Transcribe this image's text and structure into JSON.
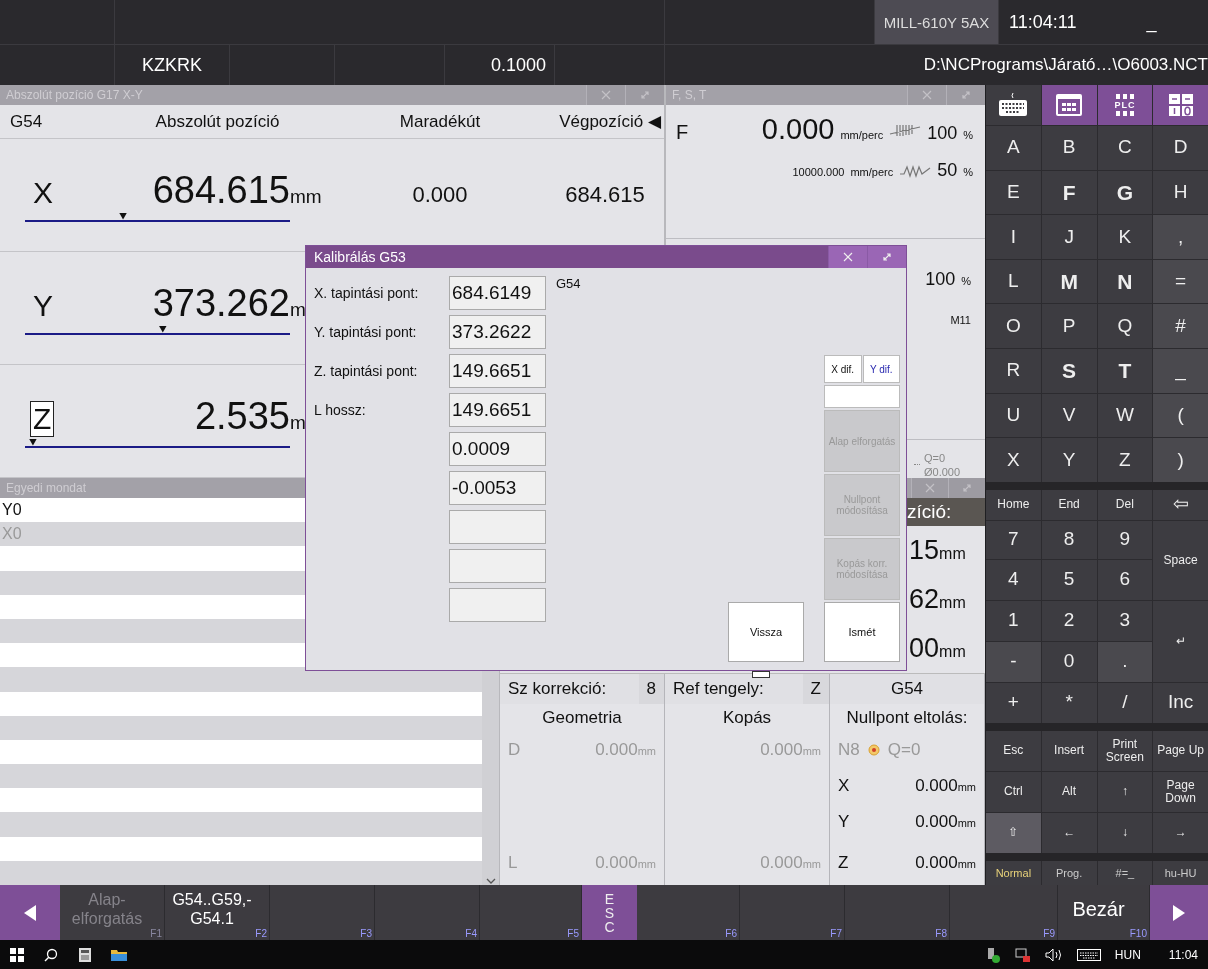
{
  "top_bar": {
    "machine": "MILL-610Y 5AX",
    "clock": "11:04:11",
    "minimize": "_",
    "mode": "KZKRK",
    "increment": "0.1000",
    "program_path": "D:\\NCPrograms\\Járató…\\O6003.NCT"
  },
  "position_panel": {
    "title": "Abszolút pozíció G17 X-Y",
    "columns": [
      "G54",
      "Abszolút pozíció",
      "Maradékút",
      "Végpozíció ◀"
    ],
    "axes": [
      {
        "axis": "X",
        "value": "684.615",
        "unit": "mm",
        "remaining": "0.000",
        "end": "684.615",
        "selected": false,
        "level": 0.37
      },
      {
        "axis": "Y",
        "value": "373.262",
        "unit": "m",
        "selected": false,
        "level": 0.52
      },
      {
        "axis": "Z",
        "value": "2.535",
        "unit": "m",
        "selected": true,
        "level": 0.03
      }
    ]
  },
  "fst_panel": {
    "title": "F, S, T",
    "feed": {
      "label": "F",
      "value": "0.000",
      "unit": "mm/perc",
      "override": "100",
      "percent": "%"
    },
    "rapid": {
      "value": "10000.000",
      "unit": "mm/perc",
      "override": "50",
      "percent": "%"
    },
    "spindle": {
      "override": "100",
      "percent": "%",
      "mcode": "M11"
    },
    "tool": {
      "q": "Q=0",
      "diameter": "Ø0.000"
    }
  },
  "single_block_panel": {
    "title": "Egyedi mondat",
    "lines": [
      {
        "text": "Y0",
        "dim": false
      },
      {
        "text": "X0",
        "dim": true
      }
    ]
  },
  "position_panel_2": {
    "heading": "zíció:",
    "values": [
      {
        "value": "15",
        "unit": "mm"
      },
      {
        "value": "62",
        "unit": "mm"
      },
      {
        "value": "00",
        "unit": "mm"
      }
    ]
  },
  "offsets": {
    "tool_corr_label": "Sz korrekció:",
    "tool_corr": "8",
    "ref_axis_label": "Ref tengely:",
    "ref_axis": "Z",
    "work_offset": "G54",
    "geometry_title": "Geometria",
    "wear_title": "Kopás",
    "zero_shift_title": "Nullpont eltolás:",
    "d_label": "D",
    "geometry_d": {
      "value": "0.000",
      "unit": "mm"
    },
    "wear_d": {
      "value": "0.000",
      "unit": "mm"
    },
    "l_label": "L",
    "geometry_l": {
      "value": "0.000",
      "unit": "mm"
    },
    "wear_l": {
      "value": "0.000",
      "unit": "mm"
    },
    "n_label": "N8",
    "q": "Q=0",
    "zero_shift": [
      {
        "axis": "X",
        "value": "0.000",
        "unit": "mm"
      },
      {
        "axis": "Y",
        "value": "0.000",
        "unit": "mm"
      },
      {
        "axis": "Z",
        "value": "0.000",
        "unit": "mm"
      }
    ]
  },
  "dialog": {
    "title": "Kalibrálás G53",
    "probe_rows": [
      {
        "label": "X. tapintási pont:",
        "value": "684.6149"
      },
      {
        "label": "Y. tapintási pont:",
        "value": "373.2622"
      },
      {
        "label": "Z. tapintási pont:",
        "value": "149.6651"
      },
      {
        "label": "L hossz:",
        "value": "149.6651"
      }
    ],
    "extra_values": [
      "0.0009",
      "-0.0053"
    ],
    "offset_name": "G54",
    "dif_toggles": [
      {
        "label": "X dif.",
        "selected": false
      },
      {
        "label": "Y dif.",
        "selected": true
      }
    ],
    "actions": [
      {
        "label": "Alap elforgatás",
        "disabled": true
      },
      {
        "label": "Nullpont módosítása",
        "disabled": true
      },
      {
        "label": "Kopás korr. módosítása",
        "disabled": true
      }
    ],
    "back": "Vissza",
    "repeat": "Ismét"
  },
  "keyboard": {
    "tabs": [
      {
        "kind": "keyboard",
        "selected": false
      },
      {
        "kind": "grid",
        "selected": true
      },
      {
        "kind": "plc",
        "label": "PLC",
        "selected": true
      },
      {
        "kind": "io",
        "selected": true
      }
    ],
    "letters": [
      {
        "label": "A",
        "kind": "letter",
        "bold": false
      },
      {
        "label": "B",
        "kind": "letter",
        "bold": false
      },
      {
        "label": "C",
        "kind": "letter",
        "bold": false
      },
      {
        "label": "D",
        "kind": "letter",
        "bold": false
      },
      {
        "label": "E",
        "kind": "letter",
        "bold": false
      },
      {
        "label": "F",
        "kind": "letter",
        "bold": true
      },
      {
        "label": "G",
        "kind": "letter",
        "bold": true
      },
      {
        "label": "H",
        "kind": "letter",
        "bold": false
      },
      {
        "label": "I",
        "kind": "letter",
        "bold": false
      },
      {
        "label": "J",
        "kind": "letter",
        "bold": false
      },
      {
        "label": "K",
        "kind": "letter",
        "bold": false
      },
      {
        "label": ",",
        "kind": "symbol",
        "bold": false
      },
      {
        "label": "L",
        "kind": "letter",
        "bold": false
      },
      {
        "label": "M",
        "kind": "letter",
        "bold": true
      },
      {
        "label": "N",
        "kind": "letter",
        "bold": true
      },
      {
        "label": "=",
        "kind": "symbol",
        "bold": false
      },
      {
        "label": "O",
        "kind": "letter",
        "bold": false
      },
      {
        "label": "P",
        "kind": "letter",
        "bold": false
      },
      {
        "label": "Q",
        "kind": "letter",
        "bold": false
      },
      {
        "label": "#",
        "kind": "symbol",
        "bold": false
      },
      {
        "label": "R",
        "kind": "letter",
        "bold": false
      },
      {
        "label": "S",
        "kind": "letter",
        "bold": true
      },
      {
        "label": "T",
        "kind": "letter",
        "bold": true
      },
      {
        "label": "_",
        "kind": "symbol",
        "bold": false
      },
      {
        "label": "U",
        "kind": "letter",
        "bold": false
      },
      {
        "label": "V",
        "kind": "letter",
        "bold": false
      },
      {
        "label": "W",
        "kind": "letter",
        "bold": false
      },
      {
        "label": "(",
        "kind": "symbol",
        "bold": false
      },
      {
        "label": "X",
        "kind": "letter",
        "bold": false
      },
      {
        "label": "Y",
        "kind": "letter",
        "bold": false
      },
      {
        "label": "Z",
        "kind": "letter",
        "bold": false
      },
      {
        "label": ")",
        "kind": "symbol",
        "bold": false
      }
    ],
    "numpad": [
      {
        "label": "Home",
        "kind": "small"
      },
      {
        "label": "End",
        "kind": "small"
      },
      {
        "label": "Del",
        "kind": "small"
      },
      {
        "label": "⇦",
        "kind": "letter"
      },
      {
        "label": "7",
        "kind": "letter"
      },
      {
        "label": "8",
        "kind": "letter"
      },
      {
        "label": "9",
        "kind": "letter"
      },
      {
        "label": "Space",
        "kind": "tall"
      },
      {
        "label": "4",
        "kind": "letter"
      },
      {
        "label": "5",
        "kind": "letter"
      },
      {
        "label": "6",
        "kind": "letter"
      },
      {
        "label": "1",
        "kind": "letter"
      },
      {
        "label": "2",
        "kind": "letter"
      },
      {
        "label": "3",
        "kind": "letter"
      },
      {
        "label": "↵",
        "kind": "tall"
      },
      {
        "label": "-",
        "kind": "symbol"
      },
      {
        "label": "0",
        "kind": "letter"
      },
      {
        "label": ".",
        "kind": "symbol"
      },
      {
        "label": "+",
        "kind": "letter"
      },
      {
        "label": "*",
        "kind": "letter"
      },
      {
        "label": "/",
        "kind": "letter"
      },
      {
        "label": "Inc",
        "kind": "letter"
      }
    ],
    "edit_keys": [
      {
        "label": "Esc",
        "active": false
      },
      {
        "label": "Insert",
        "active": false
      },
      {
        "label": "Print Screen",
        "active": false
      },
      {
        "label": "Page Up",
        "active": false
      },
      {
        "label": "Ctrl",
        "active": false
      },
      {
        "label": "Alt",
        "active": false
      },
      {
        "label": "↑",
        "active": false
      },
      {
        "label": "Page Down",
        "active": false
      },
      {
        "label": "⇧",
        "active": true
      },
      {
        "label": "←",
        "active": false
      },
      {
        "label": "↓",
        "active": false
      },
      {
        "label": "→",
        "active": false
      }
    ],
    "modes": [
      {
        "label": "Normal",
        "selected": true
      },
      {
        "label": "Prog.",
        "selected": false
      },
      {
        "label": "#=_",
        "selected": false
      },
      {
        "label": "hu-HU",
        "selected": false
      }
    ]
  },
  "function_bar": [
    {
      "kind": "arrow_left"
    },
    {
      "kind": "fkey",
      "key": "F1",
      "label": "Alap-elforgatás",
      "disabled": true
    },
    {
      "kind": "fkey",
      "key": "F2",
      "label": "G54..G59,-G54.1",
      "disabled": false
    },
    {
      "kind": "fkey",
      "key": "F3",
      "disabled": false
    },
    {
      "kind": "fkey",
      "key": "F4",
      "disabled": false
    },
    {
      "kind": "fkey",
      "key": "F5",
      "disabled": false
    },
    {
      "kind": "esc",
      "label": "ESC"
    },
    {
      "kind": "fkey",
      "key": "F6",
      "disabled": false
    },
    {
      "kind": "fkey",
      "key": "F7",
      "disabled": false
    },
    {
      "kind": "fkey",
      "key": "F8",
      "disabled": false
    },
    {
      "kind": "fkey",
      "key": "F9",
      "disabled": false
    },
    {
      "kind": "fkey",
      "key": "F10",
      "label": "Bezár",
      "disabled": false
    },
    {
      "kind": "arrow_right"
    }
  ],
  "taskbar": {
    "language": "HUN",
    "clock": "11:04"
  }
}
